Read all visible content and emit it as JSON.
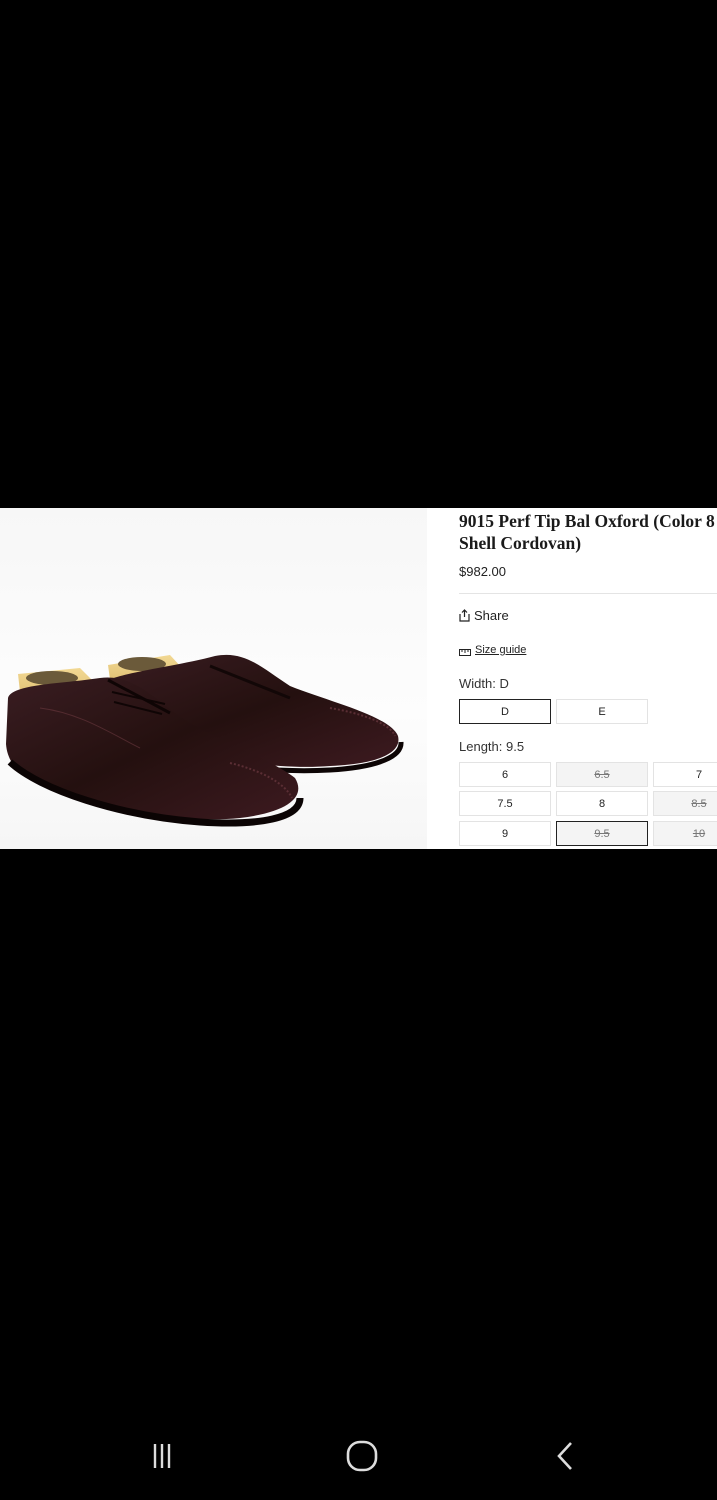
{
  "product": {
    "title": "9015 Perf Tip Bal Oxford (Color 8 Shell Cordovan)",
    "price": "$982.00",
    "image_alt": "Pair of burgundy shell cordovan cap-toe oxford shoes with shoe trees"
  },
  "actions": {
    "share_label": "Share",
    "size_guide_label": "Size guide"
  },
  "width": {
    "label": "Width:",
    "selected": "D",
    "options": [
      {
        "label": "D",
        "selected": true,
        "available": true
      },
      {
        "label": "E",
        "selected": false,
        "available": true
      }
    ]
  },
  "length": {
    "label": "Length:",
    "selected": "9.5",
    "options": [
      {
        "label": "6",
        "selected": false,
        "available": true
      },
      {
        "label": "6.5",
        "selected": false,
        "available": false
      },
      {
        "label": "7",
        "selected": false,
        "available": true
      },
      {
        "label": "7.5",
        "selected": false,
        "available": true
      },
      {
        "label": "8",
        "selected": false,
        "available": true
      },
      {
        "label": "8.5",
        "selected": false,
        "available": false
      },
      {
        "label": "9",
        "selected": false,
        "available": true
      },
      {
        "label": "9.5",
        "selected": true,
        "available": false
      },
      {
        "label": "10",
        "selected": false,
        "available": false
      }
    ]
  },
  "system_nav": {
    "recents_icon": "recents-icon",
    "home_icon": "home-icon",
    "back_icon": "back-icon"
  },
  "colors": {
    "shoe": "#2a1418",
    "shoe_trees": "#e8c879",
    "background": "#000000"
  }
}
